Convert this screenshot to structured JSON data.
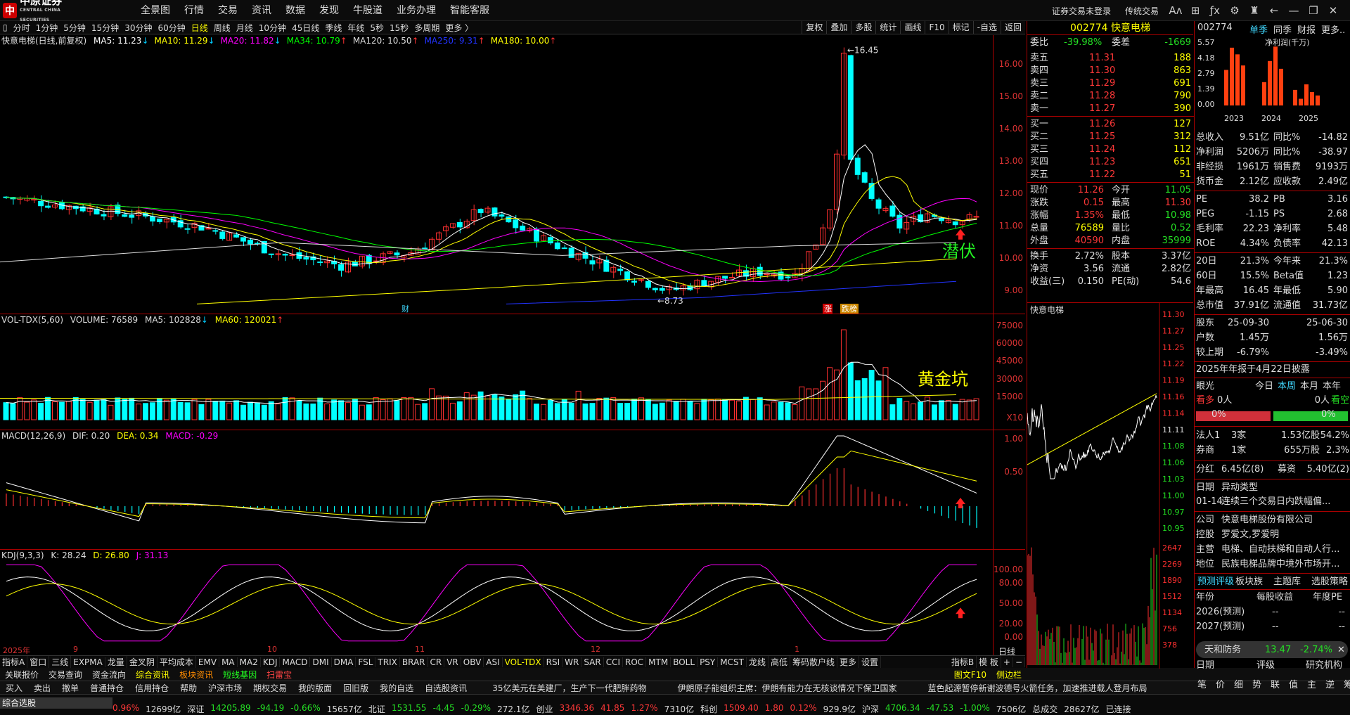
{
  "app": {
    "logo_text": "中原证券",
    "logo_sub": "CENTRAL CHINA SECURITIES",
    "menu": [
      "全景图",
      "行情",
      "交易",
      "资讯",
      "数据",
      "发现",
      "牛股道",
      "业务办理",
      "智能客服"
    ],
    "right_menu": [
      "证券交易未登录",
      "传统交易"
    ]
  },
  "periods": [
    "分时",
    "1分钟",
    "5分钟",
    "15分钟",
    "30分钟",
    "60分钟",
    "日线",
    "周线",
    "月线",
    "10分钟",
    "45日线",
    "季线",
    "年线",
    "5秒",
    "15秒",
    "多周期",
    "更多 〉"
  ],
  "active_period": "日线",
  "tool_buttons": [
    "复权",
    "叠加",
    "多股",
    "统计",
    "画线",
    "F10",
    "标记",
    "-自选",
    "返回"
  ],
  "main_chart": {
    "title": "快意电梯(日线,前复权)",
    "ma": [
      {
        "label": "MA5: 11.23",
        "color": "#ffffff",
        "arrow": "↓"
      },
      {
        "label": "MA10: 11.29",
        "color": "#ffff00",
        "arrow": "↓"
      },
      {
        "label": "MA20: 11.82",
        "color": "#ff00ff",
        "arrow": "↓"
      },
      {
        "label": "MA34: 10.79",
        "color": "#00ff00",
        "arrow": "↑"
      },
      {
        "label": "MA120: 10.50",
        "color": "#dddddd",
        "arrow": "↑"
      },
      {
        "label": "MA250: 9.31",
        "color": "#2233ff",
        "arrow": "↑"
      },
      {
        "label": "MA180: 10.00",
        "color": "#ffff00",
        "arrow": "↑"
      }
    ],
    "y_ticks": [
      "16.00",
      "15.00",
      "14.00",
      "13.00",
      "12.00",
      "11.00",
      "10.00",
      "9.00"
    ],
    "high_label": "16.45",
    "low_label": "8.73",
    "annot_green": "潜伏",
    "markers": [
      "财",
      "涨",
      "跌榜"
    ]
  },
  "volume": {
    "header": "VOL-TDX(5,60)",
    "volume": "VOLUME: 76589",
    "ma5": "MA5: 102828",
    "ma60": "MA60: 120021",
    "y_ticks": [
      "75000",
      "60000",
      "45000",
      "30000",
      "15000"
    ],
    "unit": "X10",
    "annot": "黄金坑"
  },
  "macd": {
    "header": "MACD(12,26,9)",
    "dif": "DIF: 0.20",
    "dea": "DEA: 0.34",
    "macd": "MACD: -0.29",
    "y_ticks": [
      "1.00",
      "0.50"
    ]
  },
  "kdj": {
    "header": "KDJ(9,3,3)",
    "k": "K: 28.24",
    "d": "D: 26.80",
    "j": "J: 31.13",
    "y_ticks": [
      "100.00",
      "80.00",
      "50.00",
      "20.00",
      "0.00"
    ]
  },
  "date_labels": [
    "2025年",
    "9",
    "10",
    "11",
    "12",
    "1"
  ],
  "date_right": "日线",
  "indicator_tabs": [
    "指标A",
    "窗口",
    "三线",
    "EXPMA",
    "龙量",
    "金叉阴",
    "平均成本",
    "EMV",
    "MA",
    "MA2",
    "KDJ",
    "MACD",
    "DMI",
    "DMA",
    "FSL",
    "TRIX",
    "BRAR",
    "CR",
    "VR",
    "OBV",
    "ASI",
    "VOL-TDX",
    "RSI",
    "WR",
    "SAR",
    "CCI",
    "ROC",
    "MTM",
    "BOLL",
    "PSY",
    "MCST",
    "龙线",
    "高低",
    "筹码散户线",
    "更多",
    "设置"
  ],
  "active_indicator": "VOL-TDX",
  "indicator_right": [
    "指标B",
    "模 板",
    "+",
    "−"
  ],
  "func_bar": [
    "关联报价",
    "交易查询",
    "资金流向",
    "综合资讯",
    "板块资讯",
    "短线基因",
    "扫雷宝"
  ],
  "func_right": [
    "图文F10",
    "侧边栏"
  ],
  "order_bar": [
    "买入",
    "卖出",
    "撤单",
    "普通持仓",
    "信用持仓",
    "帮助",
    "沪深市场",
    "期权交易",
    "我的版面",
    "回旧版",
    "我的自选",
    "自选股资讯"
  ],
  "news": [
    "35亿美元在美建厂，生产下一代肥胖药物",
    "伊朗原子能组织主席：伊朗有能力在无核谈情况下保卫国家",
    "蓝色起源暂停新谢波德号火箭任务，加速推进载人登月布局"
  ],
  "ticker": {
    "label": "综合选股",
    "items": [
      {
        "t": "0.96%",
        "c": "red"
      },
      {
        "t": "12699亿",
        "c": "wht"
      },
      {
        "t": "深证",
        "c": "wht"
      },
      {
        "t": "14205.89",
        "c": "green"
      },
      {
        "t": "-94.19",
        "c": "green"
      },
      {
        "t": "-0.66%",
        "c": "green"
      },
      {
        "t": "15657亿",
        "c": "wht"
      },
      {
        "t": "北证",
        "c": "wht"
      },
      {
        "t": "1531.55",
        "c": "green"
      },
      {
        "t": "-4.45",
        "c": "green"
      },
      {
        "t": "-0.29%",
        "c": "green"
      },
      {
        "t": "272.1亿",
        "c": "wht"
      },
      {
        "t": "创业",
        "c": "wht"
      },
      {
        "t": "3346.36",
        "c": "red"
      },
      {
        "t": "41.85",
        "c": "red"
      },
      {
        "t": "1.27%",
        "c": "red"
      },
      {
        "t": "7310亿",
        "c": "wht"
      },
      {
        "t": "科创",
        "c": "wht"
      },
      {
        "t": "1509.40",
        "c": "red"
      },
      {
        "t": "1.80",
        "c": "red"
      },
      {
        "t": "0.12%",
        "c": "red"
      },
      {
        "t": "929.9亿",
        "c": "wht"
      },
      {
        "t": "沪深",
        "c": "wht"
      },
      {
        "t": "4706.34",
        "c": "green"
      },
      {
        "t": "-47.53",
        "c": "green"
      },
      {
        "t": "-1.00%",
        "c": "green"
      },
      {
        "t": "7506亿",
        "c": "wht"
      },
      {
        "t": "总成交",
        "c": "wht"
      },
      {
        "t": "28627亿",
        "c": "wht"
      },
      {
        "t": "已连接",
        "c": "wht"
      }
    ]
  },
  "quote": {
    "code": "002774",
    "name": "快意电梯",
    "weibi_label": "委比",
    "weibi": "-39.98%",
    "weicha_label": "委差",
    "weicha": "-1669",
    "asks": [
      {
        "l": "卖五",
        "p": "11.31",
        "v": "188"
      },
      {
        "l": "卖四",
        "p": "11.30",
        "v": "863"
      },
      {
        "l": "卖三",
        "p": "11.29",
        "v": "691"
      },
      {
        "l": "卖二",
        "p": "11.28",
        "v": "790"
      },
      {
        "l": "卖一",
        "p": "11.27",
        "v": "390"
      }
    ],
    "bids": [
      {
        "l": "买一",
        "p": "11.26",
        "v": "127"
      },
      {
        "l": "买二",
        "p": "11.25",
        "v": "312"
      },
      {
        "l": "买三",
        "p": "11.24",
        "v": "112"
      },
      {
        "l": "买四",
        "p": "11.23",
        "v": "651"
      },
      {
        "l": "买五",
        "p": "11.22",
        "v": "51"
      }
    ],
    "stats": [
      {
        "l1": "现价",
        "v1": "11.26",
        "c1": "red",
        "l2": "今开",
        "v2": "11.05",
        "c2": "green"
      },
      {
        "l1": "涨跌",
        "v1": "0.15",
        "c1": "red",
        "l2": "最高",
        "v2": "11.30",
        "c2": "red"
      },
      {
        "l1": "涨幅",
        "v1": "1.35%",
        "c1": "red",
        "l2": "最低",
        "v2": "10.98",
        "c2": "green"
      },
      {
        "l1": "总量",
        "v1": "76589",
        "c1": "yel",
        "l2": "量比",
        "v2": "0.52",
        "c2": "green"
      },
      {
        "l1": "外盘",
        "v1": "40590",
        "c1": "red",
        "l2": "内盘",
        "v2": "35999",
        "c2": "green"
      }
    ],
    "stats2": [
      {
        "l1": "换手",
        "v1": "2.72%",
        "l2": "股本",
        "v2": "3.37亿"
      },
      {
        "l1": "净资",
        "v1": "3.56",
        "l2": "流通",
        "v2": "2.82亿"
      },
      {
        "l1": "收益(三)",
        "v1": "0.150",
        "l2": "PE(动)",
        "v2": "54.6"
      }
    ]
  },
  "mini": {
    "title": "快意电梯",
    "y_ticks": [
      "11.30",
      "11.27",
      "11.25",
      "11.22",
      "11.19",
      "11.16",
      "11.14",
      "11.11",
      "11.08",
      "11.06",
      "11.03",
      "11.00",
      "10.97",
      "10.95"
    ],
    "vol_ticks": [
      "2647",
      "2269",
      "1890",
      "1512",
      "1134",
      "756",
      "378"
    ]
  },
  "f10": {
    "code": "002774",
    "tabs": [
      "单季",
      "同季",
      "财报",
      "更多.."
    ],
    "chart_label": "净利润(千万)",
    "y_ticks": [
      "5.57",
      "4.18",
      "2.79",
      "1.39",
      "0.00"
    ],
    "years": [
      "2023",
      "2024",
      "2025"
    ],
    "bars": [
      3.2,
      5.2,
      4.6,
      3.6,
      2.1,
      4.0,
      5.3,
      3.3,
      1.4,
      0.6,
      1.9,
      1.2,
      0.9
    ],
    "fin": [
      {
        "l1": "总收入",
        "v1": "9.51亿",
        "l2": "同比%",
        "v2": "-14.82"
      },
      {
        "l1": "净利润",
        "v1": "5206万",
        "l2": "同比%",
        "v2": "-38.97"
      },
      {
        "l1": "非经损",
        "v1": "1961万",
        "l2": "销售费",
        "v2": "9193万"
      },
      {
        "l1": "货币金",
        "v1": "2.12亿",
        "l2": "应收款",
        "v2": "2.49亿"
      }
    ],
    "val": [
      {
        "l1": "PE",
        "v1": "38.2",
        "l2": "PB",
        "v2": "3.16"
      },
      {
        "l1": "PEG",
        "v1": "-1.15",
        "l2": "PS",
        "v2": "2.68"
      },
      {
        "l1": "毛利率",
        "v1": "22.23",
        "l2": "净利率",
        "v2": "5.48"
      },
      {
        "l1": "ROE",
        "v1": "4.34%",
        "l2": "负债率",
        "v2": "42.13"
      }
    ],
    "perf": [
      {
        "l1": "20日",
        "v1": "21.3%",
        "l2": "今年来",
        "v2": "21.3%"
      },
      {
        "l1": "60日",
        "v1": "15.5%",
        "l2": "Beta值",
        "v2": "1.23"
      },
      {
        "l1": "年最高",
        "v1": "16.45",
        "l2": "年最低",
        "v2": "5.90"
      },
      {
        "l1": "总市值",
        "v1": "37.91亿",
        "l2": "流通值",
        "v2": "31.73亿"
      }
    ],
    "holders": [
      {
        "l": "股东",
        "v1": "25-09-30",
        "v2": "25-06-30"
      },
      {
        "l": "户数",
        "v1": "1.45万",
        "v2": "1.56万"
      },
      {
        "l": "较上期",
        "v1": "-6.79%",
        "v2": "-3.49%"
      }
    ],
    "report": "2025年年报于4月22日披露",
    "eye": {
      "label": "眼光",
      "opts": [
        "今日",
        "本周",
        "本月",
        "本年"
      ],
      "active": "本周",
      "bull": "看多",
      "bull_n": "0人",
      "bear_n": "0人",
      "bear": "看空",
      "pct_l": "0%",
      "pct_r": "0%"
    },
    "margin": [
      {
        "l": "法人1",
        "v1": "3家",
        "v2": "1.53亿股",
        "v3": "54.2%"
      },
      {
        "l": "券商",
        "v1": "1家",
        "v2": "655万股",
        "v3": "2.3%"
      }
    ],
    "split": {
      "l": "分红",
      "v1": "6.45亿(8)",
      "l2": "募资",
      "v2": "5.40亿(2)"
    },
    "event_head": {
      "l": "日期",
      "v": "异动类型"
    },
    "event": {
      "d": "01-14",
      "t": "连续三个交易日内跌幅偏..."
    },
    "company": [
      {
        "l": "公司",
        "v": "快意电梯股份有限公司"
      },
      {
        "l": "控股",
        "v": "罗爱文,罗爱明"
      },
      {
        "l": "主营",
        "v": "电梯、自动扶梯和自动人行..."
      },
      {
        "l": "地位",
        "v": "民族电梯品牌中境外市场开..."
      }
    ],
    "forecast_tabs": [
      "预测评级",
      "板块族",
      "主题库",
      "选股策略"
    ],
    "forecast_head": [
      "年份",
      "每股收益",
      "年度PE"
    ],
    "forecast": [
      {
        "y": "2026(预测)",
        "e": "--",
        "p": "--"
      },
      {
        "y": "2027(预测)",
        "e": "--",
        "p": "--"
      }
    ],
    "sector": {
      "name": "天和防务",
      "price": "13.47",
      "chg": "-2.74%"
    },
    "rating_head": [
      "日期",
      "评级",
      "研究机构"
    ],
    "bottom_tabs": [
      "笔",
      "价",
      "细",
      "势",
      "联",
      "值",
      "主",
      "逆",
      "筹"
    ]
  }
}
